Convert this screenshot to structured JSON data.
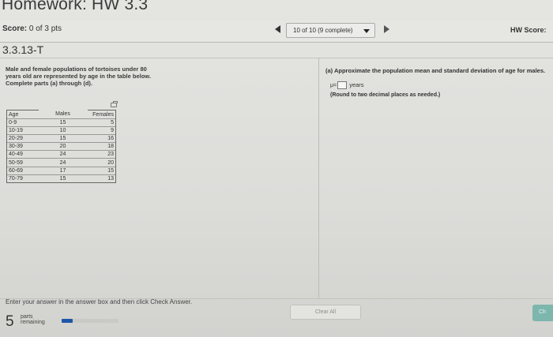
{
  "header": {
    "title": "Homework: HW 3.3",
    "score_label": "Score:",
    "score_value": "0 of 3 pts",
    "nav_label": "10 of 10 (9 complete)",
    "hw_score_label": "HW Score:"
  },
  "question": {
    "id": "3.3.13-T",
    "text": "Male and female populations of tortoises under 80 years old are represented by age in the table below. Complete parts (a) through (d).",
    "table": {
      "headers": [
        "Age",
        "Males",
        "Females"
      ],
      "rows": [
        [
          "0-9",
          "15",
          "5"
        ],
        [
          "10-19",
          "10",
          "9"
        ],
        [
          "20-29",
          "15",
          "16"
        ],
        [
          "30-39",
          "20",
          "18"
        ],
        [
          "40-49",
          "24",
          "23"
        ],
        [
          "50-59",
          "24",
          "20"
        ],
        [
          "60-69",
          "17",
          "15"
        ],
        [
          "70-79",
          "15",
          "13"
        ]
      ]
    }
  },
  "answer": {
    "part_a": "(a) Approximate the population mean and standard deviation of age for males.",
    "mu_symbol": "μ=",
    "mu_value": "",
    "unit": "years",
    "rounding_note": "(Round to two decimal places as needed.)"
  },
  "footer": {
    "instruction": "Enter your answer in the answer box and then click Check Answer.",
    "parts_count": "5",
    "parts_label_1": "parts",
    "parts_label_2": "remaining",
    "progress_fraction": 0.2,
    "clear_all_label": "Clear All",
    "check_label": "Ch"
  },
  "colors": {
    "progress_fill": "#1d57a8",
    "check_button": "#7cb6ac"
  }
}
